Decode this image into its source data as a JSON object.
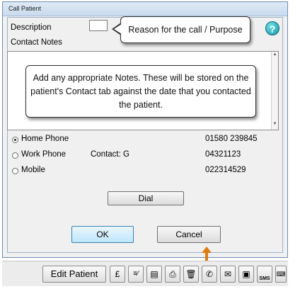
{
  "window": {
    "title": "Call Patient"
  },
  "form": {
    "description_label": "Description",
    "contact_notes_label": "Contact Notes",
    "description_value": ""
  },
  "callouts": {
    "reason": "Reason for the call / Purpose",
    "notes": "Add any appropriate Notes. These will be stored on the patient's Contact tab against the date that you contacted the patient."
  },
  "help_icon": "?",
  "phones": [
    {
      "label": "Home Phone",
      "number": "01580 239845",
      "selected": true,
      "contact": ""
    },
    {
      "label": "Work Phone",
      "number": "04321123",
      "selected": false,
      "contact": "Contact: G"
    },
    {
      "label": "Mobile",
      "number": "022314529",
      "selected": false,
      "contact": ""
    }
  ],
  "buttons": {
    "dial": "Dial",
    "ok": "OK",
    "cancel": "Cancel"
  },
  "toolbar": {
    "edit_patient": "Edit Patient",
    "icons": [
      "pound-icon",
      "cheque-icon",
      "document-icon",
      "print-icon",
      "trash-icon",
      "phone-icon",
      "letter-icon",
      "address-card-icon",
      "sms-icon",
      "keyboard-icon"
    ],
    "sms_label": "SMS"
  },
  "colors": {
    "highlight_arrow": "#e07a10",
    "help_icon": "#1797a6",
    "ok_border": "#3c7fb1"
  }
}
